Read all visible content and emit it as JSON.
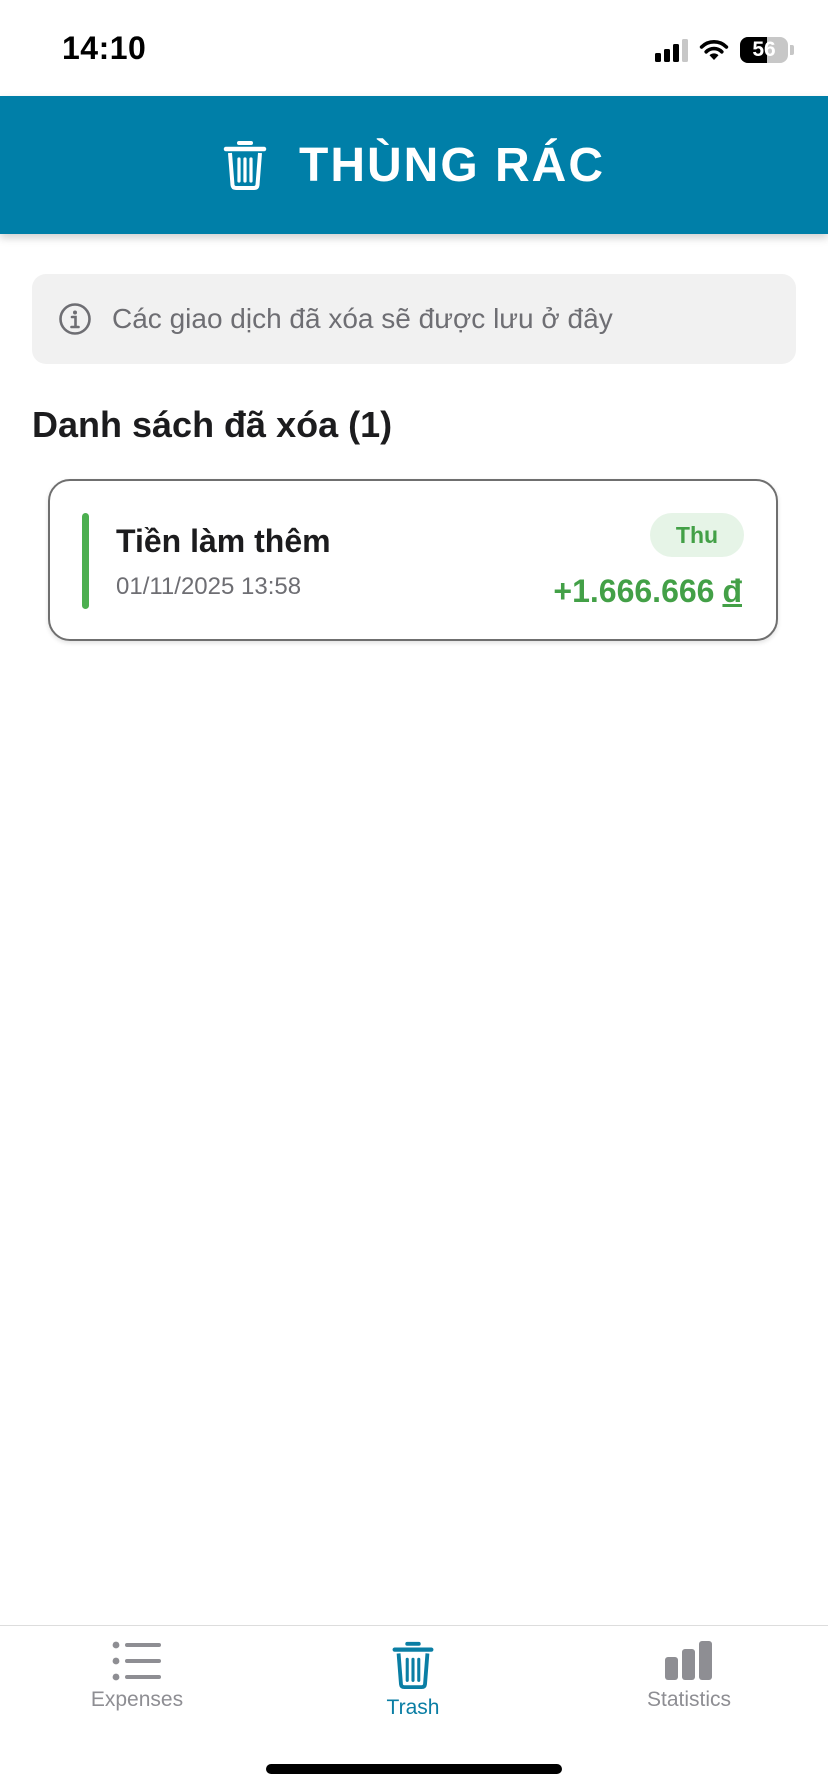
{
  "status_bar": {
    "time": "14:10",
    "battery_level": "56",
    "icons": [
      "cellular-signal-icon",
      "wifi-icon",
      "battery-icon"
    ]
  },
  "header": {
    "title": "THÙNG RÁC",
    "icon": "trash-icon",
    "background_color": "#007fa8"
  },
  "info_banner": {
    "icon": "info-icon",
    "text": "Các giao dịch đã xóa sẽ được lưu ở đây"
  },
  "deleted_list": {
    "title": "Danh sách đã xóa (1)",
    "items": [
      {
        "name": "Tiền làm thêm",
        "datetime": "01/11/2025 13:58",
        "type_badge": "Thu",
        "amount": "+1.666.666",
        "currency": "đ",
        "accent_color": "#4caf50"
      }
    ]
  },
  "tab_bar": {
    "active_color": "#0a7ea4",
    "tabs": [
      {
        "label": "Expenses",
        "icon": "list-icon",
        "active": false
      },
      {
        "label": "Trash",
        "icon": "trash-icon",
        "active": true
      },
      {
        "label": "Statistics",
        "icon": "bar-chart-icon",
        "active": false
      }
    ]
  }
}
